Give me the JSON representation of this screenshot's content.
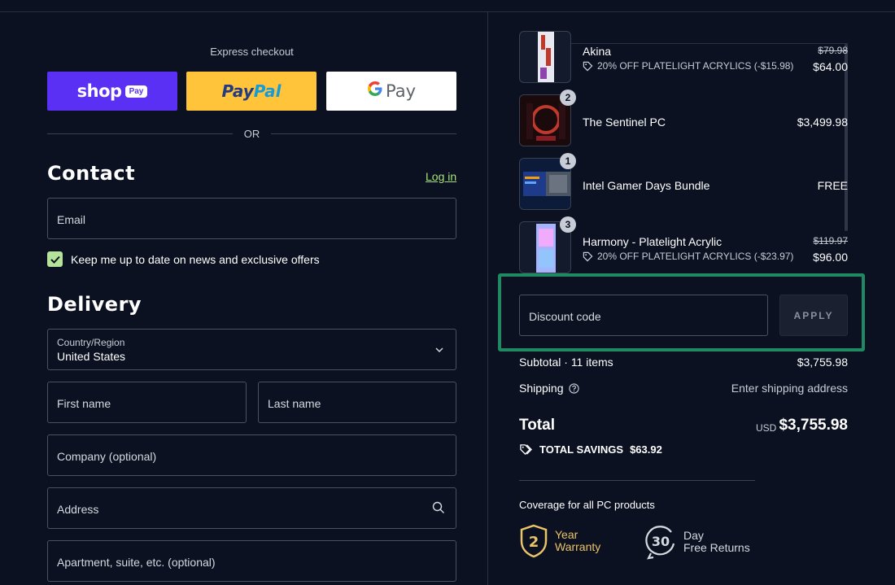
{
  "express": {
    "title": "Express checkout",
    "shop_word": "shop",
    "shop_pay": "Pay",
    "paypal_a": "Pay",
    "paypal_b": "Pal",
    "gpay_word": "Pay",
    "or_text": "OR"
  },
  "contact": {
    "heading": "Contact",
    "login": "Log in",
    "email_placeholder": "Email",
    "newsletter_label": "Keep me up to date on news and exclusive offers",
    "newsletter_checked": true
  },
  "delivery": {
    "heading": "Delivery",
    "country_label": "Country/Region",
    "country_value": "United States",
    "first_name": "First name",
    "last_name": "Last name",
    "company": "Company (optional)",
    "address": "Address",
    "apartment": "Apartment, suite, etc. (optional)"
  },
  "cart": {
    "items": [
      {
        "name": "Akina",
        "discount": "20% OFF PLATELIGHT ACRYLICS (-$15.98)",
        "price_old": "$79.98",
        "price": "$64.00"
      },
      {
        "name": "The Sentinel PC",
        "qty": "2",
        "price": "$3,499.98"
      },
      {
        "name": "Intel Gamer Days Bundle",
        "qty": "1",
        "price": "FREE"
      },
      {
        "name": "Harmony - Platelight Acrylic",
        "qty": "3",
        "discount": "20% OFF PLATELIGHT ACRYLICS (-$23.97)",
        "price_old": "$119.97",
        "price": "$96.00"
      }
    ]
  },
  "discount": {
    "placeholder": "Discount code",
    "apply_label": "APPLY"
  },
  "summary": {
    "subtotal_label": "Subtotal · 11 items",
    "subtotal_value": "$3,755.98",
    "shipping_label": "Shipping",
    "shipping_value": "Enter shipping address",
    "total_label": "Total",
    "currency": "USD",
    "total_value": "$3,755.98",
    "savings_label": "TOTAL SAVINGS",
    "savings_value": "$63.92"
  },
  "coverage": {
    "title": "Coverage for all PC products",
    "warranty_number": "2",
    "warranty_line1": "Year",
    "warranty_line2": "Warranty",
    "returns_number": "30",
    "returns_line1": "Day",
    "returns_line2": "Free Returns"
  },
  "colors": {
    "background": "#0b1120",
    "accent_green": "#1f8a62",
    "checkbox": "#b6e39a",
    "link": "#a6e37a",
    "shop_purple": "#5a31f4",
    "paypal_yellow": "#ffc439",
    "warranty_gold": "#e9c46a"
  }
}
